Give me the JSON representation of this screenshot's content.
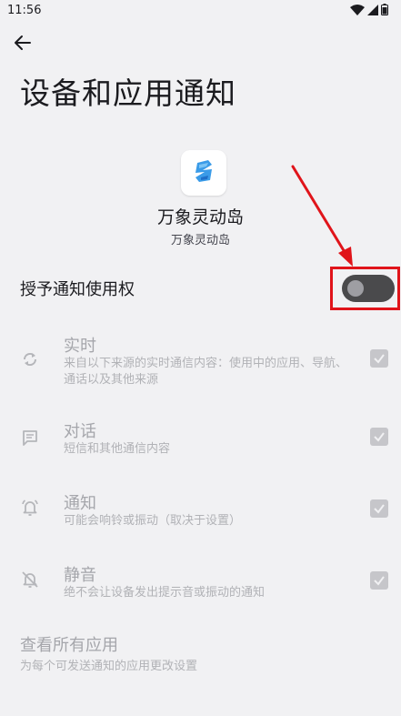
{
  "status_bar": {
    "time": "11:56",
    "icons": [
      "wifi-icon",
      "signal-icon",
      "battery-icon"
    ]
  },
  "header": {
    "back_icon": "arrow-left-icon",
    "title": "设备和应用通知"
  },
  "app": {
    "icon": "app-logo-icon",
    "name": "万象灵动岛",
    "subname": "万象灵动岛"
  },
  "grant": {
    "label": "授予通知使用权",
    "enabled": false
  },
  "permissions": [
    {
      "title": "实时",
      "desc": "来自以下来源的实时通信内容：使用中的应用、导航、通话以及其他来源",
      "icon": "sync-icon",
      "checked": true
    },
    {
      "title": "对话",
      "desc": "短信和其他通信内容",
      "icon": "chat-icon",
      "checked": true
    },
    {
      "title": "通知",
      "desc": "可能会响铃或振动（取决于设置）",
      "icon": "bell-ring-icon",
      "checked": true
    },
    {
      "title": "静音",
      "desc": "绝不会让设备发出提示音或振动的通知",
      "icon": "bell-off-icon",
      "checked": true
    }
  ],
  "all_apps": {
    "title": "查看所有应用",
    "desc": "为每个可发送通知的应用更改设置"
  },
  "colors": {
    "background": "#f1f1f3",
    "toggle_track": "#4a4a4c",
    "annotation_red": "#e0141a",
    "disabled_text": "#a5a6ab"
  }
}
